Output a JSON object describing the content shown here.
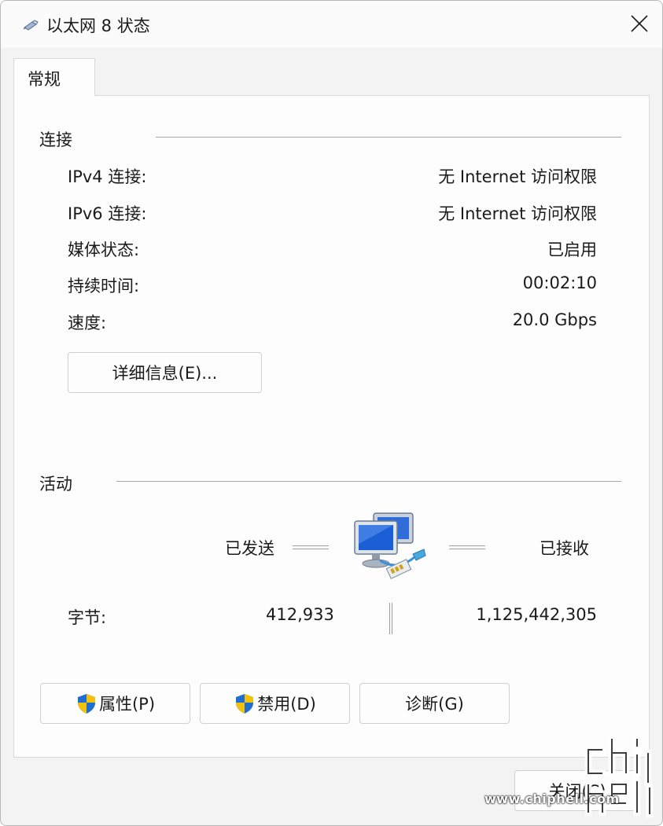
{
  "window": {
    "title": "以太网 8 状态",
    "icons": {
      "title": "network-adapter-icon",
      "close": "close-icon"
    }
  },
  "tabs": [
    {
      "label": "常规",
      "selected": true
    }
  ],
  "connection": {
    "group_title": "连接",
    "rows": [
      {
        "label": "IPv4 连接:",
        "value": "无 Internet 访问权限"
      },
      {
        "label": "IPv6 连接:",
        "value": "无 Internet 访问权限"
      },
      {
        "label": "媒体状态:",
        "value": "已启用"
      },
      {
        "label": "持续时间:",
        "value": "00:02:10"
      },
      {
        "label": "速度:",
        "value": "20.0 Gbps"
      }
    ],
    "details_button": "详细信息(E)..."
  },
  "activity": {
    "group_title": "活动",
    "sent_label": "已发送",
    "received_label": "已接收",
    "bytes_label": "字节:",
    "bytes_sent": "412,933",
    "bytes_received": "1,125,442,305",
    "icon": "network-computers-icon"
  },
  "buttons": {
    "properties": "属性(P)",
    "disable": "禁用(D)",
    "diagnose": "诊断(G)",
    "close": "关闭(C)",
    "shield_icon": "uac-shield-icon"
  },
  "watermark": {
    "url": "www.chiphell.com",
    "logo_text": "chip hell"
  },
  "colors": {
    "window_bg": "#f3f3f3",
    "panel_bg": "#fdfdfd",
    "accent_blue": "#1a5fd6"
  }
}
